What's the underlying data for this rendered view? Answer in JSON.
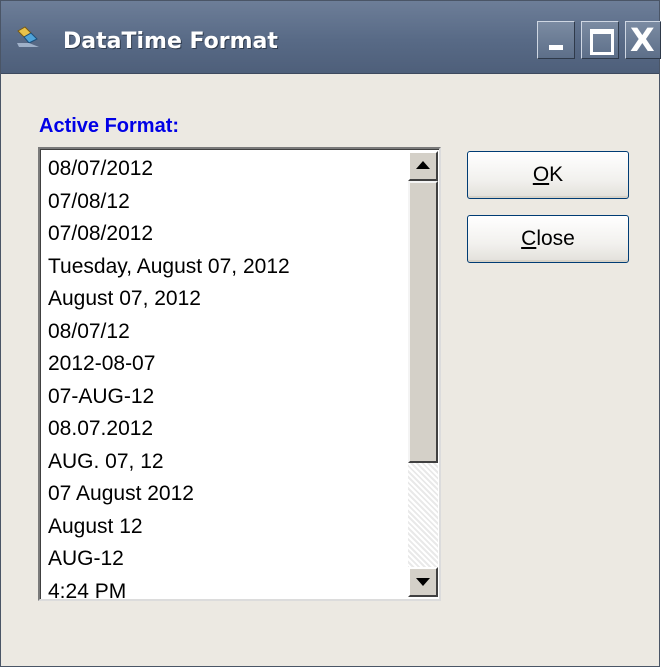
{
  "window": {
    "title": "DataTime Format",
    "controls": {
      "minimize_icon": "minimize-icon",
      "maximize_icon": "maximize-icon",
      "close_icon": "close-icon",
      "close_glyph": "X"
    }
  },
  "main": {
    "list_label": "Active Format:",
    "formats": [
      "08/07/2012",
      "07/08/12",
      "07/08/2012",
      "Tuesday, August 07, 2012",
      "August 07, 2012",
      "08/07/12",
      "2012-08-07",
      "07-AUG-12",
      "08.07.2012",
      "AUG. 07, 12",
      "07 August 2012",
      "August 12",
      "AUG-12",
      "4:24 PM"
    ]
  },
  "buttons": {
    "ok_mnemonic": "O",
    "ok_rest": "K",
    "close_mnemonic": "C",
    "close_rest": "lose"
  },
  "colors": {
    "titlebar": "#586a86",
    "label": "#0000e6",
    "window_bg": "#ece9e2"
  }
}
